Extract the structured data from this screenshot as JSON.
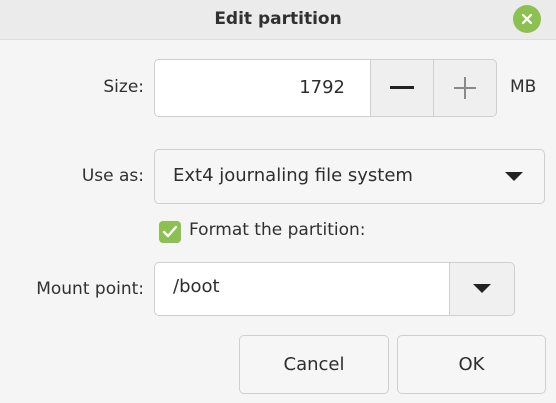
{
  "dialog": {
    "title": "Edit partition",
    "close_icon": "close-icon"
  },
  "size": {
    "label": "Size:",
    "value": "1792",
    "unit": "MB",
    "decrease_icon": "minus-icon",
    "increase_icon": "plus-icon"
  },
  "use_as": {
    "label": "Use as:",
    "selected": "Ext4 journaling file system"
  },
  "format": {
    "label": "Format the partition:",
    "checked": true
  },
  "mount_point": {
    "label": "Mount point:",
    "value": "/boot"
  },
  "buttons": {
    "cancel": "Cancel",
    "ok": "OK"
  },
  "colors": {
    "accent": "#8cc152",
    "window_bg": "#f5f5f5",
    "titlebar_bg": "#ebebeb"
  }
}
